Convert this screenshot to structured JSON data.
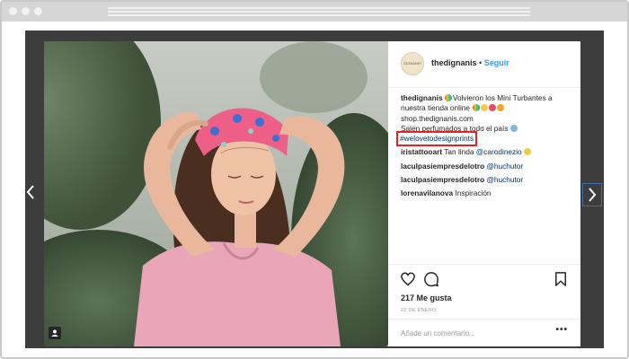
{
  "post": {
    "username": "thedignanis",
    "follow_separator": "•",
    "follow_label": "Seguir",
    "avatar_text": "DIGNANIS",
    "caption_user": "thedignanis",
    "caption_line1": "Volvieron los Mini Turbantes a nuestra tienda online",
    "caption_line2": "shop.thedignanis.com",
    "caption_line3": "Salen perfumados a todo el país",
    "caption_hashtag": "#welovetodesignprints",
    "comments": [
      {
        "user": "iristattooart",
        "text": "Tan linda",
        "mention": "@carodinezio"
      },
      {
        "user": "laculpasiempresdelotro",
        "text": "",
        "mention": "@huchutor"
      },
      {
        "user": "laculpasiempresdelotro",
        "text": "",
        "mention": "@huchutor"
      },
      {
        "user": "lorenavilanova",
        "text": "Inspiración",
        "mention": ""
      }
    ],
    "likes": "217 Me gusta",
    "date": "22 DE ENERO",
    "comment_placeholder": "Añade un comentario...",
    "more_label": "•••"
  },
  "icons": {
    "like": "heart-outline-icon",
    "comment": "speech-bubble-icon",
    "save": "bookmark-icon",
    "prev": "chevron-left-icon",
    "next": "chevron-right-icon",
    "tag": "user-tag-icon"
  },
  "colors": {
    "link_blue": "#3897f0",
    "highlight_red": "#e52222",
    "viewer_bg": "#3d3d3d"
  }
}
